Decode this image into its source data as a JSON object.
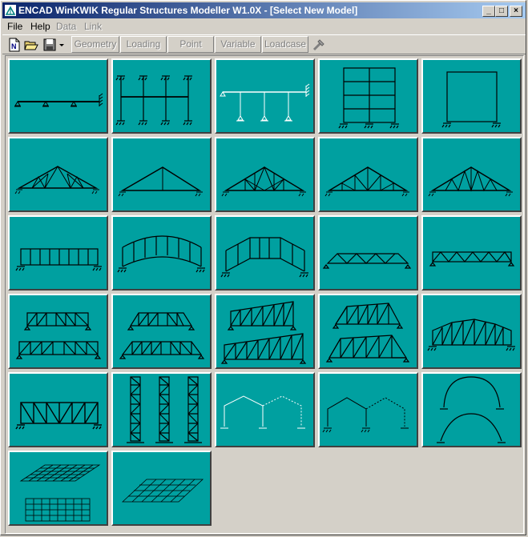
{
  "window": {
    "title": "ENCAD WinKWIK Regular Structures Modeller W1.0X - [Select New Model]",
    "controls": [
      "_",
      "□",
      "×"
    ]
  },
  "menu": {
    "file": "File",
    "help": "Help",
    "data": "Data",
    "link": "Link"
  },
  "toolbar": {
    "icons": [
      "new-file-icon",
      "open-folder-icon",
      "save-disk-icon",
      "dropdown-arrow-icon",
      "tools-icon"
    ],
    "geometry": "Geometry",
    "loading": "Loading",
    "point": "Point",
    "variable": "Variable",
    "loadcase": "Loadcase"
  },
  "models": [
    "continuous-beam",
    "multi-storey-frame-plan",
    "beam-on-columns",
    "multi-storey-frame",
    "portal-frame",
    "fink-truss",
    "simple-truss",
    "howe-truss",
    "pratt-truss",
    "warren-truss",
    "vierendeel-girder",
    "arched-vierendeel",
    "gabled-vierendeel",
    "warren-girder",
    "flat-warren-girder",
    "n-girder-pair",
    "bowstring-truss-pair",
    "sloped-truss-pair",
    "curved-truss-pair",
    "trapezoid-truss",
    "n-truss",
    "lattice-towers",
    "multi-bay-portal",
    "multi-bay-portal-2",
    "arches",
    "grillage-pair",
    "grillage-skew"
  ],
  "colors": {
    "tile": "#00a0a0",
    "titlebar_start": "#0a246a",
    "titlebar_end": "#a6caf0",
    "face": "#d4d0c8"
  }
}
